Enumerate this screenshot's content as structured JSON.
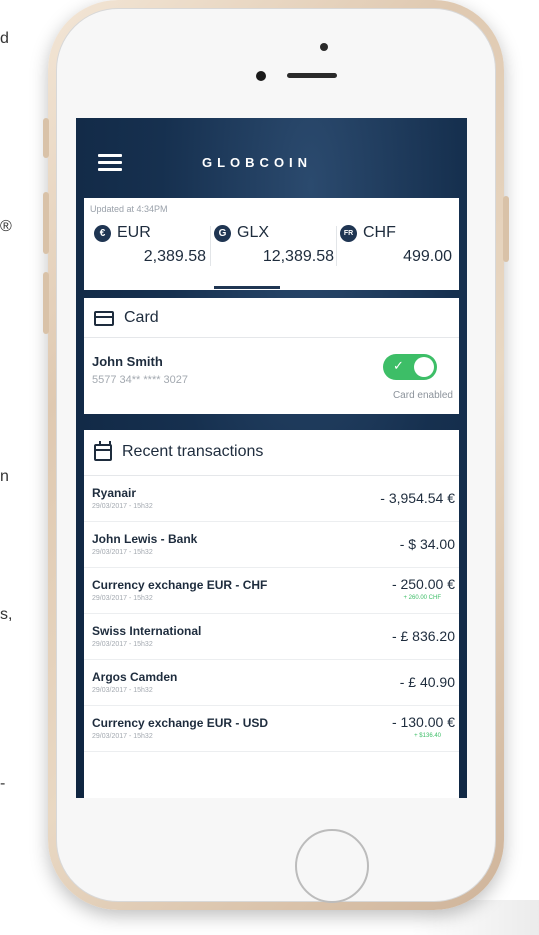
{
  "left_fragments": [
    "d",
    "®",
    "n",
    "s,",
    "-"
  ],
  "app": {
    "logo": "GLOBCOIN"
  },
  "currencies": {
    "updated": "Updated at 4:34PM",
    "items": [
      {
        "code": "EUR",
        "icon": "euro-icon",
        "glyph": "€",
        "value": "2,389.58"
      },
      {
        "code": "GLX",
        "icon": "globcoin-icon",
        "glyph": "G",
        "value": "12,389.58"
      },
      {
        "code": "CHF",
        "icon": "franc-icon",
        "glyph": "FR",
        "value": "499.00"
      }
    ]
  },
  "card": {
    "title": "Card",
    "holder": "John Smith",
    "number": "5577 34** **** 3027",
    "status": "Card enabled",
    "enabled": true
  },
  "transactions": {
    "title": "Recent transactions",
    "items": [
      {
        "name": "Ryanair",
        "date": "29/03/2017 - 15h32",
        "amount": "- 3,954.54 €",
        "sub": ""
      },
      {
        "name": "John Lewis - Bank",
        "date": "29/03/2017 - 15h32",
        "amount": "- $ 34.00",
        "sub": ""
      },
      {
        "name": "Currency exchange EUR - CHF",
        "date": "29/03/2017 - 15h32",
        "amount": "- 250.00 €",
        "sub": "+ 260.00 CHF"
      },
      {
        "name": "Swiss International",
        "date": "29/03/2017 - 15h32",
        "amount": "- £ 836.20",
        "sub": ""
      },
      {
        "name": "Argos Camden",
        "date": "29/03/2017 - 15h32",
        "amount": "- £ 40.90",
        "sub": ""
      },
      {
        "name": "Currency exchange EUR - USD",
        "date": "29/03/2017 - 15h32",
        "amount": "- 130.00 €",
        "sub": "+ $136.40"
      }
    ]
  },
  "colors": {
    "navy": "#16304f",
    "accent_green": "#3dbe67",
    "phone_gold": "#dfc9b1"
  }
}
